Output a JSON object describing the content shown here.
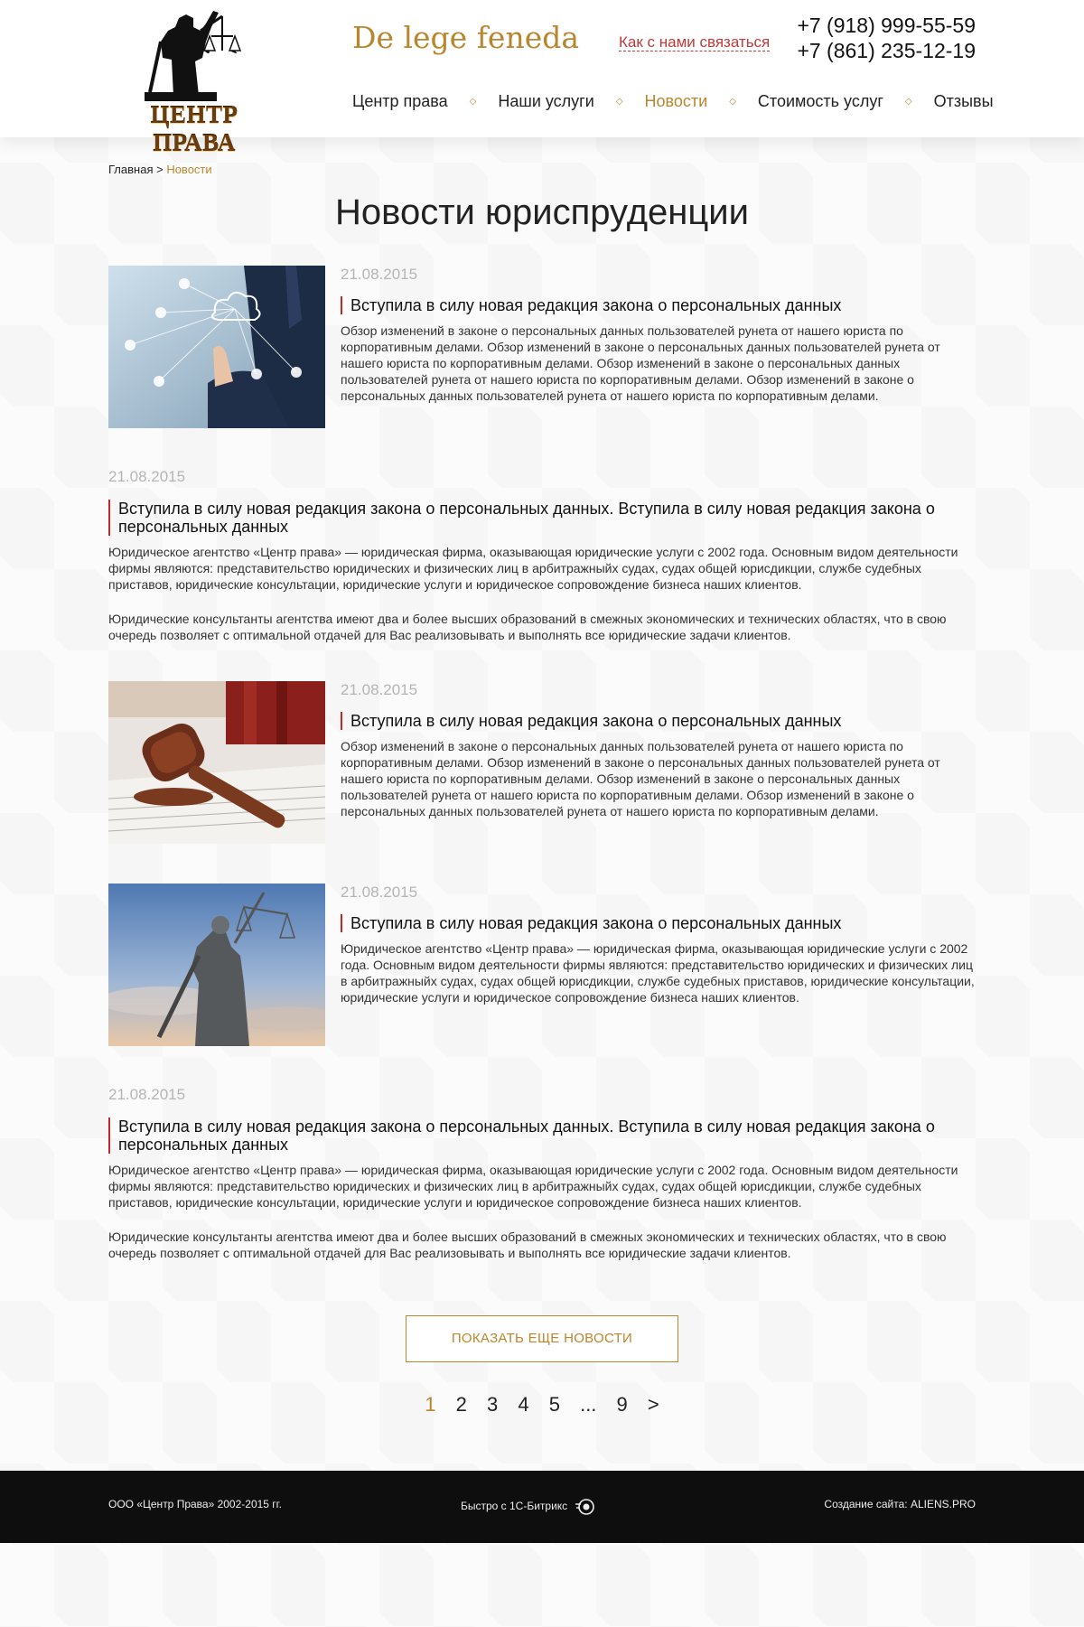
{
  "header": {
    "logo_text": "ЦЕНТР ПРАВА",
    "tagline": "De lege feneda",
    "contact_link": "Как с нами связаться",
    "phone1": "+7 (918) 999-55-59",
    "phone2": "+7 (861) 235-12-19"
  },
  "nav": {
    "items": [
      {
        "label": "Центр права"
      },
      {
        "label": "Наши услуги"
      },
      {
        "label": "Новости"
      },
      {
        "label": "Стоимость услуг"
      },
      {
        "label": "Отзывы"
      }
    ],
    "active": "Новости"
  },
  "breadcrumb": {
    "home": "Главная",
    "sep": " > ",
    "current": "Новости"
  },
  "page_title": "Новости юриспруденции",
  "news": [
    {
      "date": "21.08.2015",
      "title": "Вступила в силу новая редакция закона о персональных данных",
      "text": "Обзор изменений в законе о персональных данных пользователей рунета от нашего юриста по корпоративным делами. Обзор изменений в законе о персональных данных пользователей рунета от нашего юриста по корпоративным делами. Обзор изменений в законе о персональных данных пользователей рунета от нашего юриста по корпоративным делами. Обзор изменений в законе о персональных данных пользователей рунета от нашего юриста по корпоративным делами.",
      "image": "cloud-tech-icon"
    },
    {
      "date": "21.08.2015",
      "title": "Вступила в силу новая редакция закона о персональных данных. Вступила в силу новая редакция закона о персональных данных",
      "text": "Юридическое агентство «Центр права» — юридическая фирма, оказывающая юридические услуги с 2002 года. Основным видом деятельности фирмы являются: представительство юридических и физических лиц в арбитражныйх судах, судах общей юрисдикции, службе судебных приставов, юридические консультации, юридические услуги и юридическое сопровождение бизнеса наших клиентов.",
      "text2": "Юридические консультанты агентства имеют два и более высших образований в смежных экономических и технических областях, что в свою очередь позволяет с оптимальной отдачей для Вас реализовывать и выполнять все юридические задачи клиентов."
    },
    {
      "date": "21.08.2015",
      "title": "Вступила в силу новая редакция закона о персональных данных",
      "text": "Обзор изменений в законе о персональных данных пользователей рунета от нашего юриста по корпоративным делами. Обзор изменений в законе о персональных данных пользователей рунета от нашего юриста по корпоративным делами. Обзор изменений в законе о персональных данных пользователей рунета от нашего юриста по корпоративным делами. Обзор изменений в законе о персональных данных пользователей рунета от нашего юриста по корпоративным делами.",
      "image": "gavel-icon"
    },
    {
      "date": "21.08.2015",
      "title": "Вступила в силу новая редакция закона о персональных данных",
      "text": "Юридическое агентство «Центр права» — юридическая фирма, оказывающая юридические услуги с 2002 года. Основным видом деятельности фирмы являются: представительство юридических и физических лиц в арбитражныйх судах, судах общей юрисдикции, службе судебных приставов, юридические консультации, юридические услуги и юридическое сопровождение бизнеса наших клиентов.",
      "image": "themis-statue-icon"
    },
    {
      "date": "21.08.2015",
      "title": "Вступила в силу новая редакция закона о персональных данных. Вступила в силу новая редакция закона о персональных данных",
      "text": "Юридическое агентство «Центр права» — юридическая фирма, оказывающая юридические услуги с 2002 года. Основным видом деятельности фирмы являются: представительство юридических и физических лиц в арбитражныйх судах, судах общей юрисдикции, службе судебных приставов, юридические консультации, юридические услуги и юридическое сопровождение бизнеса наших клиентов.",
      "text2": "Юридические консультанты агентства имеют два и более высших образований в смежных экономических и технических областях, что в свою очередь позволяет с оптимальной отдачей для Вас реализовывать и выполнять все юридические задачи клиентов."
    }
  ],
  "more_button": "ПОКАЗАТЬ ЕЩЕ НОВОСТИ",
  "pagination": {
    "pages": [
      "1",
      "2",
      "3",
      "4",
      "5",
      "...",
      "9",
      ">"
    ],
    "active": "1"
  },
  "footer": {
    "copyright": "ООО «Центр Права» 2002-2015 гг.",
    "bitrix": "Быстро с 1С-Битрикс",
    "made_label": "Создание сайта: ",
    "made_link": "ALIENS.PRO"
  },
  "colors": {
    "accent": "#b8862f",
    "title_bar": "#c62828",
    "date": "#b5b5b5",
    "footer_bg": "#0e0e0e"
  }
}
